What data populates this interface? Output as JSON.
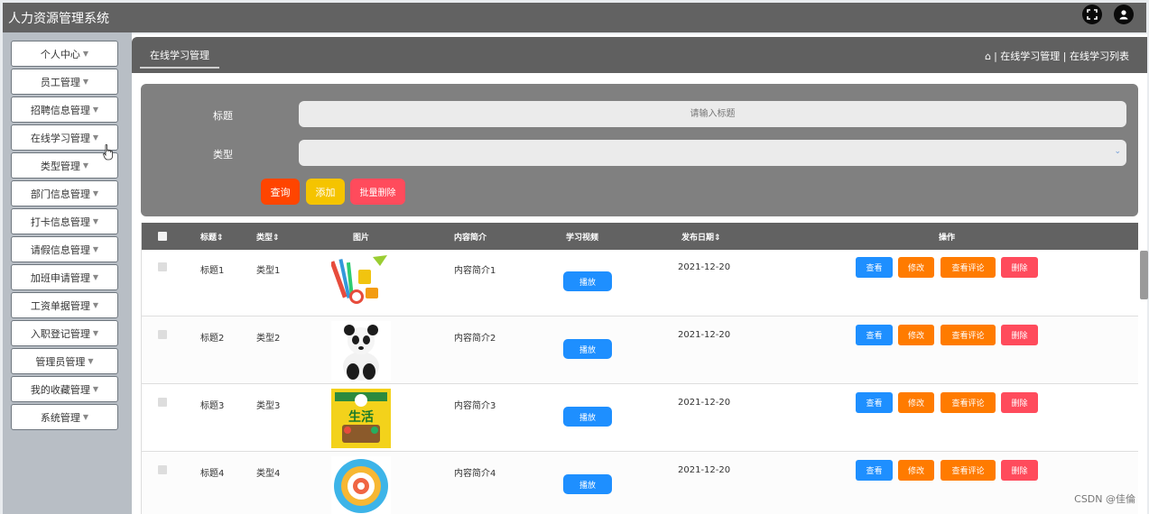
{
  "app": {
    "title": "人力资源管理系统"
  },
  "top_icons": [
    {
      "name": "fullscreen-icon",
      "glyph": "⤢"
    },
    {
      "name": "user-icon",
      "glyph": "●"
    }
  ],
  "sidebar": {
    "items": [
      {
        "label": "个人中心"
      },
      {
        "label": "员工管理"
      },
      {
        "label": "招聘信息管理"
      },
      {
        "label": "在线学习管理"
      },
      {
        "label": "类型管理"
      },
      {
        "label": "部门信息管理"
      },
      {
        "label": "打卡信息管理"
      },
      {
        "label": "请假信息管理"
      },
      {
        "label": "加班申请管理"
      },
      {
        "label": "工资单据管理"
      },
      {
        "label": "入职登记管理"
      },
      {
        "label": "管理员管理"
      },
      {
        "label": "我的收藏管理"
      },
      {
        "label": "系统管理"
      }
    ],
    "caret": "▼"
  },
  "header": {
    "tab_label": "在线学习管理",
    "home_icon": "⌂",
    "breadcrumb": "| 在线学习管理 | 在线学习列表"
  },
  "search": {
    "title_label": "标题",
    "title_placeholder": "请输入标题",
    "type_label": "类型",
    "type_value": "",
    "select_caret": "⌄",
    "query_button": "查询",
    "add_button": "添加",
    "batch_delete_button": "批量删除"
  },
  "colors": {
    "query": "#ff4500",
    "add": "#f5c400",
    "batch_delete": "#ff4b5c",
    "view": "#1e8fff",
    "edit": "#ff7b00",
    "comments": "#ff7b00",
    "delete": "#ff4b5c",
    "play": "#1e8fff"
  },
  "table": {
    "headers": {
      "title": "标题⇕",
      "type": "类型⇕",
      "image": "图片",
      "summary": "内容简介",
      "video": "学习视频",
      "date": "发布日期⇕",
      "actions": "操作"
    },
    "rows": [
      {
        "title": "标题1",
        "type": "类型1",
        "image": "stationery-image",
        "summary": "内容简介1",
        "play": "播放",
        "date": "2021-12-20"
      },
      {
        "title": "标题2",
        "type": "类型2",
        "image": "panda-image",
        "summary": "内容简介2",
        "play": "播放",
        "date": "2021-12-20"
      },
      {
        "title": "标题3",
        "type": "类型3",
        "image": "life-book-image",
        "summary": "内容简介3",
        "play": "播放",
        "date": "2021-12-20"
      },
      {
        "title": "标题4",
        "type": "类型4",
        "image": "circle-chart-image",
        "summary": "内容简介4",
        "play": "播放",
        "date": "2021-12-20"
      }
    ],
    "action_labels": {
      "view": "查看",
      "edit": "修改",
      "comments": "查看评论",
      "delete": "删除"
    },
    "life_book_text": "生活"
  },
  "watermark": "CSDN @佳倫"
}
